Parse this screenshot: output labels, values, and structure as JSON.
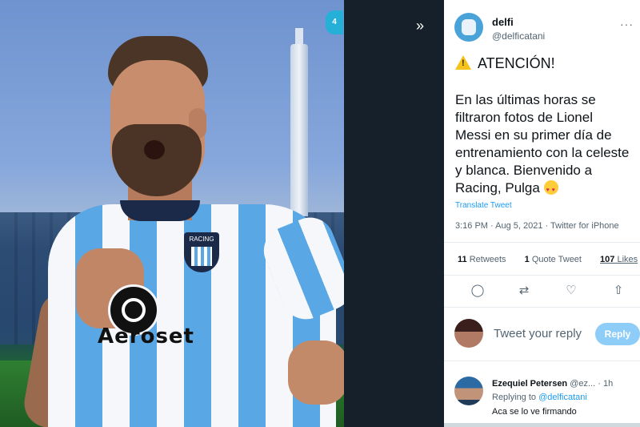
{
  "photo": {
    "corner_badge": "4",
    "crest_label": "RACING",
    "sponsor": "Aeroset"
  },
  "tweet": {
    "author_name": "delfi",
    "author_handle": "@delficatani",
    "headline": "ATENCIÓN!",
    "body": "En las últimas horas se\nfiltraron fotos de Lionel\nMessi en su primer día de\nentrenamiento con la celeste\ny blanca. Bienvenido a\nRacing, Pulga",
    "translate_label": "Translate Tweet",
    "meta": "3:16 PM · Aug 5, 2021 · Twitter for iPhone",
    "retweets_count": "11",
    "retweets_label": "Retweets",
    "quote_count": "1",
    "quote_label": "Quote Tweet",
    "likes_count": "107",
    "likes_label": "Likes"
  },
  "composer": {
    "placeholder": "Tweet your reply",
    "reply_button": "Reply"
  },
  "reply": {
    "name": "Ezequiel Petersen",
    "handle_time": "@ez... · 1h",
    "replying_prefix": "Replying to",
    "replying_to": "@delficatani",
    "text": "Aca se lo ve firmando"
  },
  "icons": {
    "expand": "expand-icon",
    "more": "more-icon",
    "warning": "warning-icon",
    "reply": "reply-icon",
    "retweet": "retweet-icon",
    "like": "heart-icon",
    "share": "share-icon"
  },
  "colors": {
    "accent": "#1d9bf0",
    "reply_button": "#8ecdf8",
    "dark_background": "#15202b"
  }
}
